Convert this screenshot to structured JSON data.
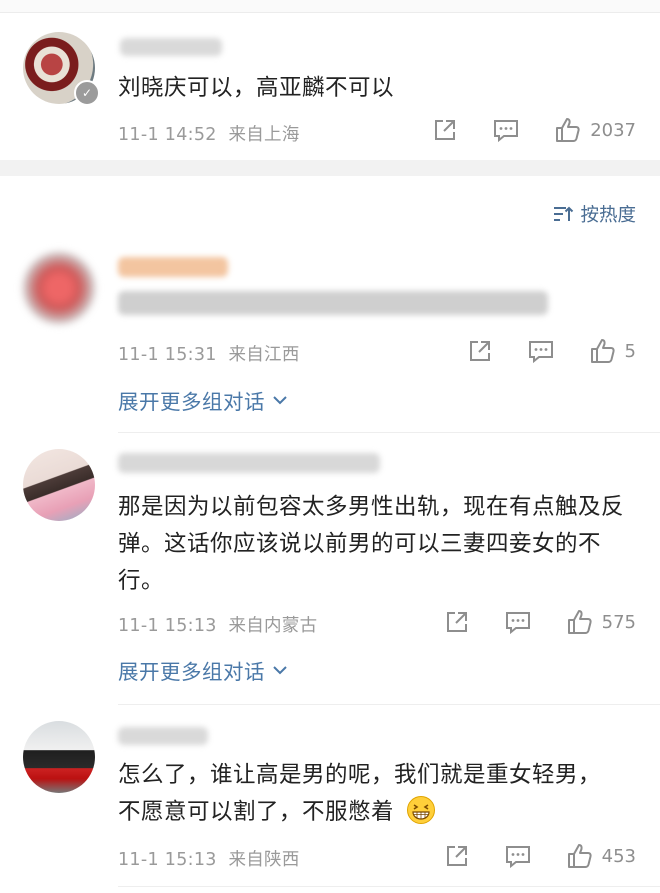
{
  "sort": {
    "label": "按热度"
  },
  "top_comment": {
    "text": "刘晓庆可以，高亚麟不可以",
    "time": "11-1 14:52",
    "location": "来自上海",
    "likes": "2037"
  },
  "replies": [
    {
      "time": "11-1 15:31",
      "location": "来自江西",
      "likes": "5",
      "expand": "展开更多组对话"
    },
    {
      "text": "那是因为以前包容太多男性出轨，现在有点触及反弹。这话你应该说以前男的可以三妻四妾女的不行。",
      "time": "11-1 15:13",
      "location": "来自内蒙古",
      "likes": "575",
      "expand": "展开更多组对话"
    },
    {
      "text": "怎么了，谁让高是男的呢，我们就是重女轻男，不愿意可以割了，不服憋着",
      "time": "11-1 15:13",
      "location": "来自陕西",
      "likes": "453"
    }
  ],
  "icons": [
    "share-icon",
    "comment-icon",
    "like-icon",
    "sort-icon",
    "chevron-down-icon",
    "verified-badge-icon",
    "grin-emoji-icon"
  ]
}
